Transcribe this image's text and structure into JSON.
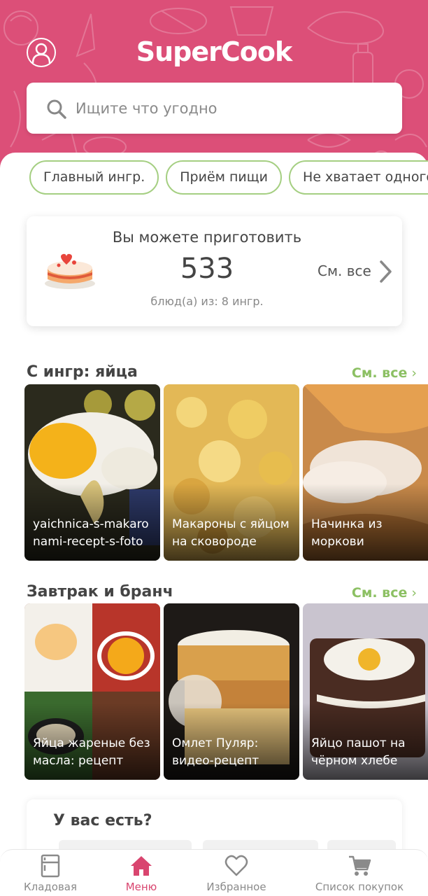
{
  "app": {
    "title": "SuperCook"
  },
  "search": {
    "placeholder": "Ищите что угодно"
  },
  "chips": [
    "Главный ингр.",
    "Приём пищи",
    "Не хватает одного"
  ],
  "summary": {
    "title": "Вы можете приготовить",
    "count": "533",
    "subtitle": "блюд(а) из: 8 ингр.",
    "see_all": "См. все"
  },
  "sections": [
    {
      "title": "С ингр: яйца",
      "see_all": "См. все",
      "recipes": [
        {
          "label": "yaichnica-s-makaronami-recept-s-foto"
        },
        {
          "label": "Макароны с яйцом на сковороде"
        },
        {
          "label": "Начинка из моркови"
        }
      ]
    },
    {
      "title": "Завтрак и бранч",
      "see_all": "См. все",
      "recipes": [
        {
          "label": "Яйца жареные без масла: рецепт"
        },
        {
          "label": "Омлет Пуляр: видео-рецепт"
        },
        {
          "label": "Яйцо пашот на чёрном хлебе"
        }
      ]
    }
  ],
  "have": {
    "title": "У вас есть?"
  },
  "tabs": [
    {
      "label": "Кладовая",
      "icon": "pantry-icon",
      "active": false
    },
    {
      "label": "Меню",
      "icon": "home-icon",
      "active": true
    },
    {
      "label": "Избранное",
      "icon": "heart-icon",
      "active": false
    },
    {
      "label": "Список покупок",
      "icon": "cart-icon",
      "active": false
    }
  ],
  "colors": {
    "brand": "#dc4f78",
    "accent_green": "#8cc063",
    "chip_border": "#a5cf82",
    "active_tab": "#d9456f"
  }
}
